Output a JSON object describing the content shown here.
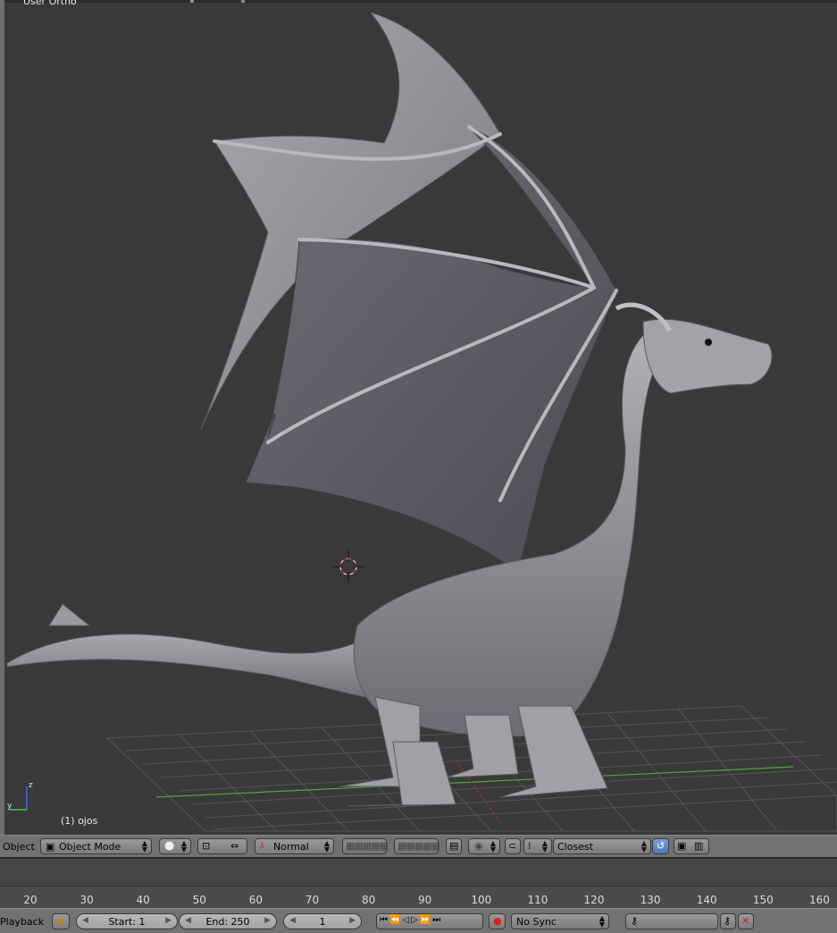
{
  "viewport": {
    "view_name": "User Ortho",
    "object_info": "(1) ojos"
  },
  "header": {
    "menu_label": "Object",
    "mode": "Object Mode",
    "pivot": "Normal",
    "snap_target": "Closest"
  },
  "timeline": {
    "ticks": [
      "20",
      "30",
      "40",
      "50",
      "60",
      "70",
      "80",
      "90",
      "100",
      "110",
      "120",
      "130",
      "140",
      "150",
      "160"
    ]
  },
  "footer": {
    "menu_label": "Playback",
    "start": "Start: 1",
    "end": "End: 250",
    "current_frame": "1",
    "sync": "No Sync"
  },
  "colors": {
    "viewport_bg": "#393939",
    "grid": "#555555",
    "x_axis": "#4aa83a",
    "model": "#8e8e94",
    "header": "#727272"
  },
  "icons": [
    "object-cube-icon",
    "shading-sphere-icon",
    "pivot-icon",
    "manipulator-icon",
    "layers-icon",
    "snap-icon",
    "record-icon",
    "play-icon",
    "keying-icon"
  ]
}
